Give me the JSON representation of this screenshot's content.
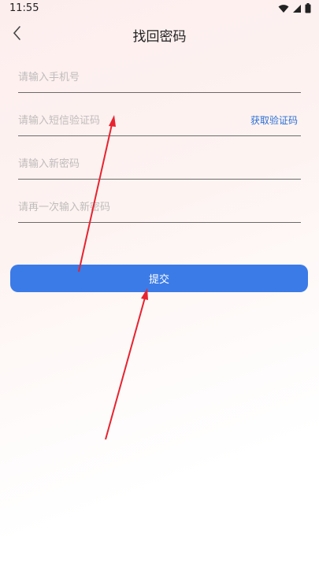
{
  "status": {
    "time": "11:55"
  },
  "nav": {
    "title": "找回密码"
  },
  "form": {
    "phone_placeholder": "请输入手机号",
    "sms_placeholder": "请输入短信验证码",
    "get_code_label": "获取验证码",
    "new_password_placeholder": "请输入新密码",
    "confirm_password_placeholder": "请再一次输入新密码",
    "submit_label": "提交"
  },
  "colors": {
    "accent": "#3b7be8",
    "link": "#2c6fd6",
    "annotation": "#e8232f"
  },
  "icons": [
    "wifi-icon",
    "signal-icon",
    "battery-icon",
    "back-chevron-icon"
  ]
}
